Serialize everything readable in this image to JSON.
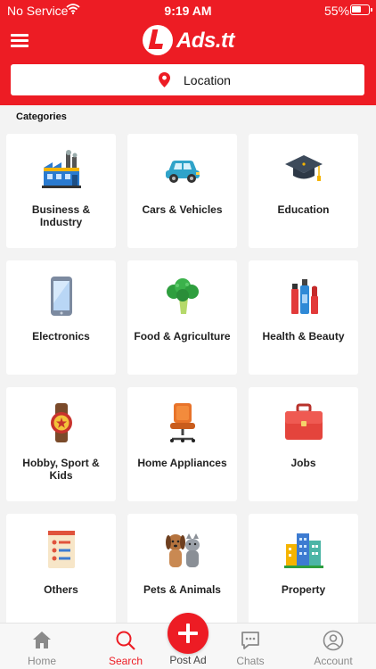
{
  "status_bar": {
    "carrier": "No Service",
    "time": "9:19 AM",
    "battery": "55%",
    "battery_level": 0.55
  },
  "header": {
    "brand": "Ads.tt",
    "location_label": "Location",
    "colors": {
      "brand_red": "#ed1c24"
    }
  },
  "categories_title": "Categories",
  "categories": [
    {
      "label": "Business & Industry",
      "icon": "factory-icon"
    },
    {
      "label": "Cars & Vehicles",
      "icon": "car-icon"
    },
    {
      "label": "Education",
      "icon": "graduation-cap-icon"
    },
    {
      "label": "Electronics",
      "icon": "smartphone-icon"
    },
    {
      "label": "Food & Agriculture",
      "icon": "broccoli-icon"
    },
    {
      "label": "Health & Beauty",
      "icon": "cosmetics-icon"
    },
    {
      "label": "Hobby, Sport & Kids",
      "icon": "wristwatch-icon"
    },
    {
      "label": "Home Appliances",
      "icon": "office-chair-icon"
    },
    {
      "label": "Jobs",
      "icon": "briefcase-icon"
    },
    {
      "label": "Others",
      "icon": "checklist-icon"
    },
    {
      "label": "Pets & Animals",
      "icon": "dog-cat-icon"
    },
    {
      "label": "Property",
      "icon": "buildings-icon"
    }
  ],
  "tab_bar": {
    "home": "Home",
    "search": "Search",
    "post_ad": "Post Ad",
    "chats": "Chats",
    "account": "Account",
    "active_tab": "search"
  }
}
